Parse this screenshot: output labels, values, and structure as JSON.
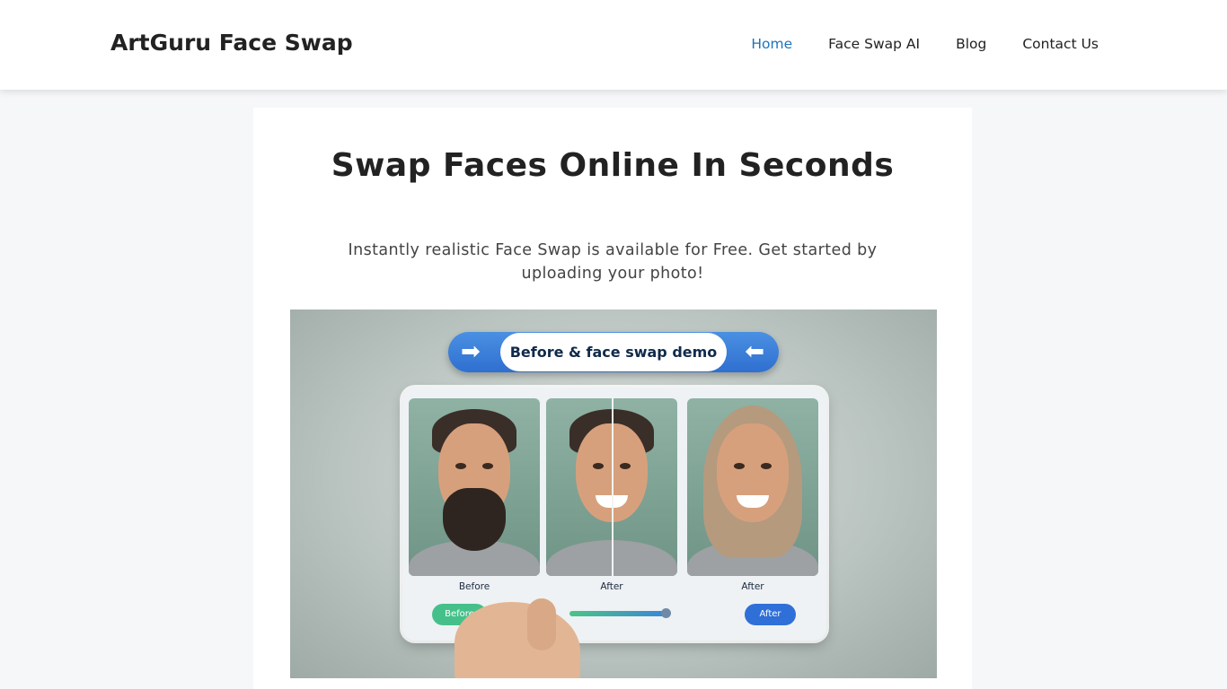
{
  "header": {
    "brand": "ArtGuru Face Swap",
    "nav": [
      "Home",
      "Face Swap AI",
      "Blog",
      "Contact Us"
    ],
    "active_nav": "Home",
    "accent_color": "#1e73be"
  },
  "main": {
    "title": "Swap Faces Online In Seconds",
    "subtitle": "Instantly realistic Face Swap is available for Free. Get started by uploading your photo!"
  },
  "hero_image": {
    "banner_text": "Before & face swap demo",
    "captions": [
      "Before",
      "After",
      "After"
    ],
    "before_button": "Before",
    "after_button": "After",
    "left_arrow_icon": "arrow-right-icon",
    "right_arrow_icon": "arrow-left-icon"
  }
}
